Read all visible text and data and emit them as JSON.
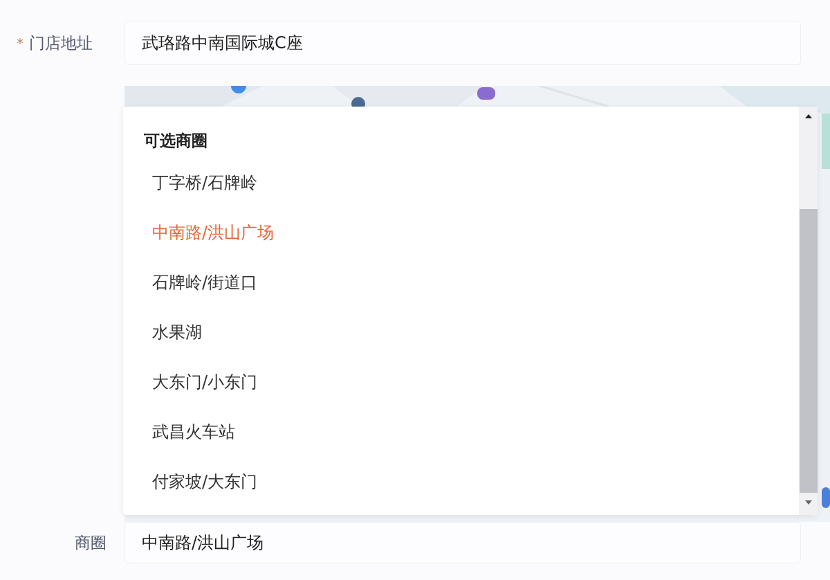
{
  "address": {
    "required_mark": "*",
    "label": "门店地址",
    "value": "武珞路中南国际城C座"
  },
  "dropdown": {
    "title": "可选商圈",
    "options": [
      {
        "label": "丁字桥/石牌岭",
        "selected": false
      },
      {
        "label": "中南路/洪山广场",
        "selected": true
      },
      {
        "label": "石牌岭/街道口",
        "selected": false
      },
      {
        "label": "水果湖",
        "selected": false
      },
      {
        "label": "大东门/小东门",
        "selected": false
      },
      {
        "label": "武昌火车站",
        "selected": false
      },
      {
        "label": "付家坡/大东门",
        "selected": false
      }
    ]
  },
  "district": {
    "label": "商圈",
    "value": "中南路/洪山广场"
  }
}
